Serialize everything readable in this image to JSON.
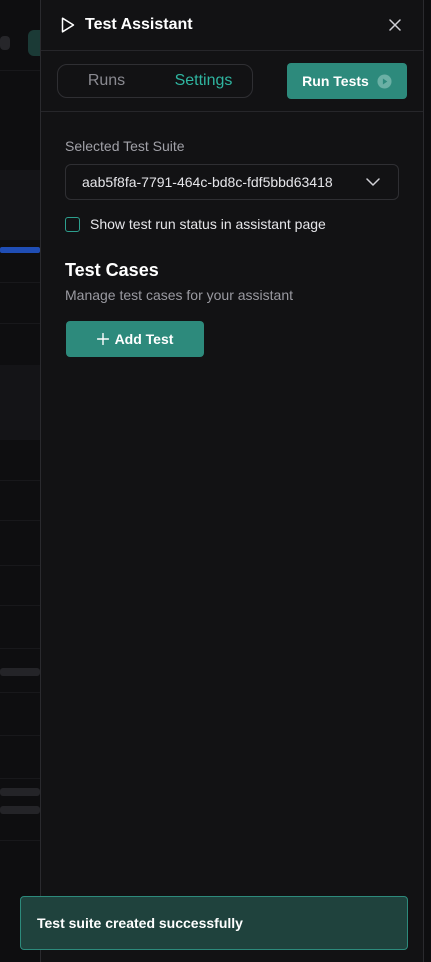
{
  "header": {
    "title": "Test Assistant"
  },
  "tabs": [
    {
      "label": "Runs",
      "active": false
    },
    {
      "label": "Settings",
      "active": true
    }
  ],
  "run_tests_label": "Run Tests",
  "settings": {
    "suite_label": "Selected Test Suite",
    "suite_value": "aab5f8fa-7791-464c-bd8c-fdf5bbd63418",
    "show_status_label": "Show test run status in assistant page",
    "show_status_checked": false
  },
  "test_cases": {
    "title": "Test Cases",
    "subtitle": "Manage test cases for your assistant",
    "add_label": "Add Test"
  },
  "toast": {
    "message": "Test suite created successfully"
  },
  "colors": {
    "accent": "#2d8a7c",
    "accent_text": "#2fb5a0",
    "panel_bg": "#121214",
    "toast_bg": "#1f423d"
  },
  "icons": [
    "play-outline-icon",
    "close-icon",
    "play-circle-icon",
    "chevron-down-icon",
    "plus-icon"
  ]
}
